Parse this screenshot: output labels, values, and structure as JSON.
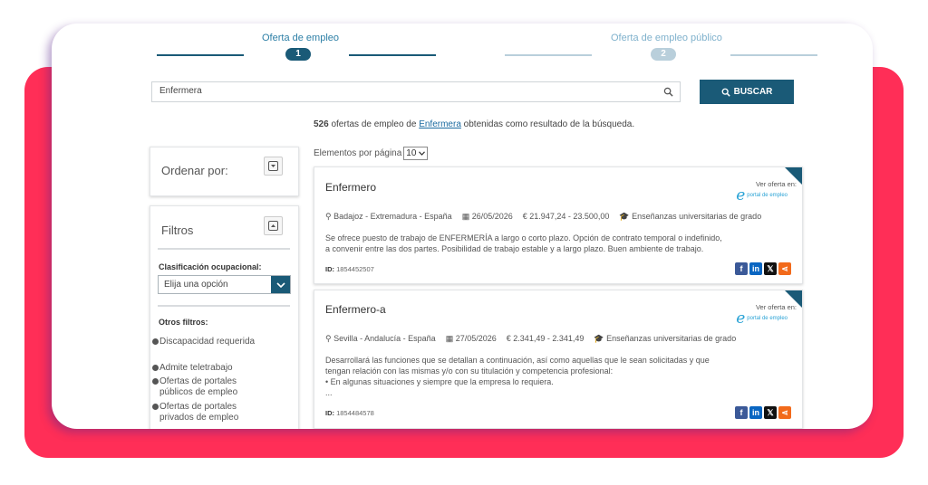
{
  "stepper": {
    "step1": {
      "label": "Oferta de empleo",
      "number": "1"
    },
    "step2": {
      "label": "Oferta de empleo público",
      "number": "2"
    }
  },
  "search": {
    "value": "Enfermera",
    "button_label": "BUSCAR"
  },
  "results": {
    "count": "526",
    "text_before": " ofertas de empleo de ",
    "term": "Enfermera",
    "text_after": " obtenidas como resultado de la búsqueda."
  },
  "sidebar": {
    "order_title": "Ordenar por:",
    "filters_title": "Filtros",
    "classification_label": "Clasificación ocupacional:",
    "classification_placeholder": "Elija una opción",
    "other_filters_label": "Otros filtros:",
    "other_filters": [
      "Discapacidad requerida",
      "Admite teletrabajo",
      "Ofertas de portales públicos de empleo",
      "Ofertas de portales privados de empleo"
    ]
  },
  "pagination": {
    "per_page_label": "Elementos por página",
    "per_page_value": "10"
  },
  "offers": [
    {
      "title": "Enfermero",
      "location": "Badajoz - Extremadura - España",
      "date": "26/05/2026",
      "salary": "21.947,24 - 23.500,00",
      "education": "Enseñanzas universitarias de grado",
      "description": "Se ofrece puesto de trabajo de ENFERMERÍA a largo o corto plazo. Opción de contrato temporal o indefinido, a convenir entre las dos partes. Posibilidad de trabajo estable y a largo plazo. Buen ambiente de trabajo.",
      "id_label": "ID:",
      "id": "1854452507",
      "ver_label": "Ver oferta en:",
      "portal": "portal de empleo"
    },
    {
      "title": "Enfermero-a",
      "location": "Sevilla - Andalucía - España",
      "date": "27/05/2026",
      "salary": "2.341,49 - 2.341,49",
      "education": "Enseñanzas universitarias de grado",
      "description_lines": [
        "Desarrollará las funciones que se detallan a continuación, así como aquellas que le sean solicitadas y que",
        "tengan relación con las mismas y/o con su titulación y competencia profesional:",
        "•      En algunas situaciones y siempre que la empresa lo requiera.",
        "..."
      ],
      "id_label": "ID:",
      "id": "1854484578",
      "ver_label": "Ver oferta en:",
      "portal": "portal de empleo"
    }
  ],
  "colors": {
    "brand_dark": "#1a5a77",
    "accent_red": "#ff2e57",
    "step_inactive": "#b9cfdb",
    "link": "#1a6aa0"
  }
}
